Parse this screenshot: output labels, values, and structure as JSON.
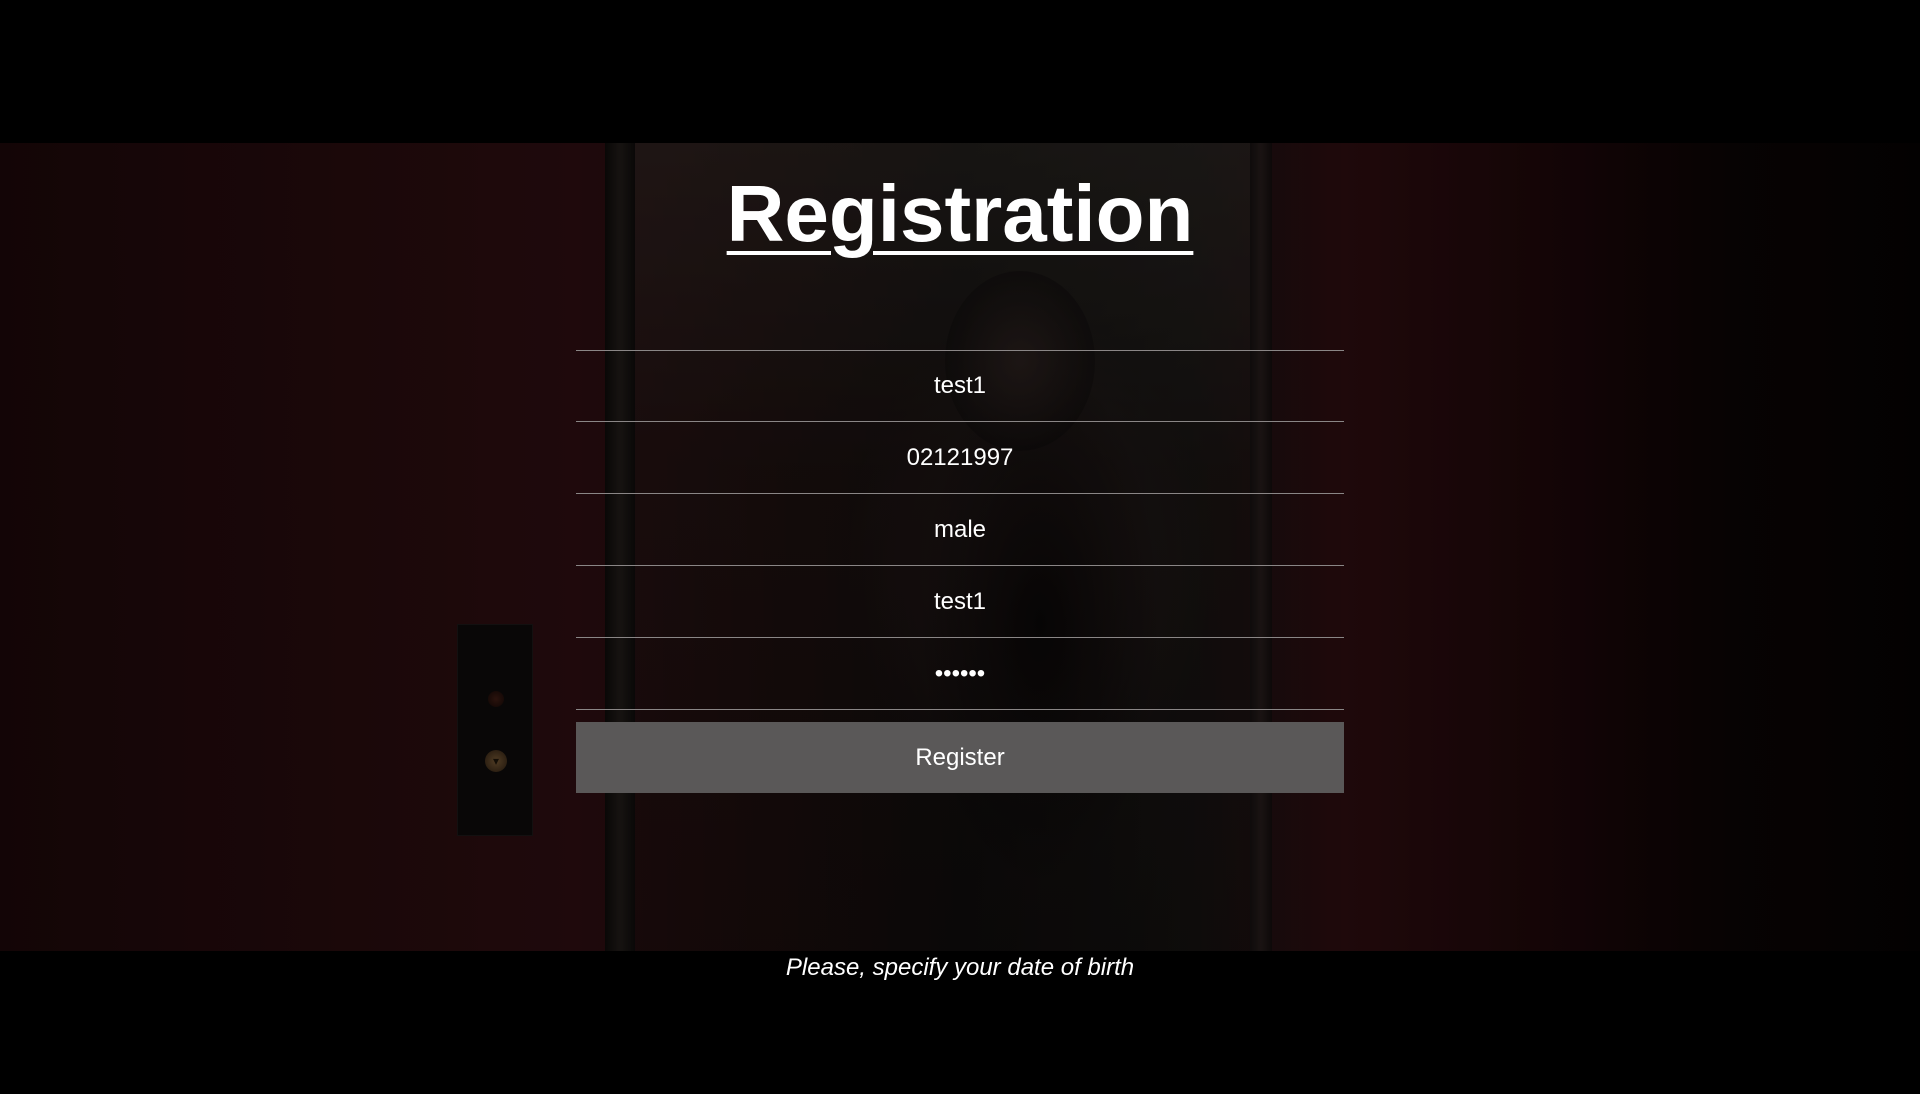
{
  "page": {
    "title": "Registration"
  },
  "form": {
    "fields": [
      {
        "name": "username",
        "value": "test1"
      },
      {
        "name": "date_of_birth",
        "value": "02121997"
      },
      {
        "name": "gender",
        "value": "male"
      },
      {
        "name": "login",
        "value": "test1"
      },
      {
        "name": "password",
        "value": "••••••"
      }
    ],
    "register_label": "Register"
  },
  "subtitle": {
    "text": "Please, specify your date of birth"
  },
  "colors": {
    "background": "#000000",
    "text": "#ffffff",
    "divider": "#8a8686",
    "button": "#5a5858"
  }
}
